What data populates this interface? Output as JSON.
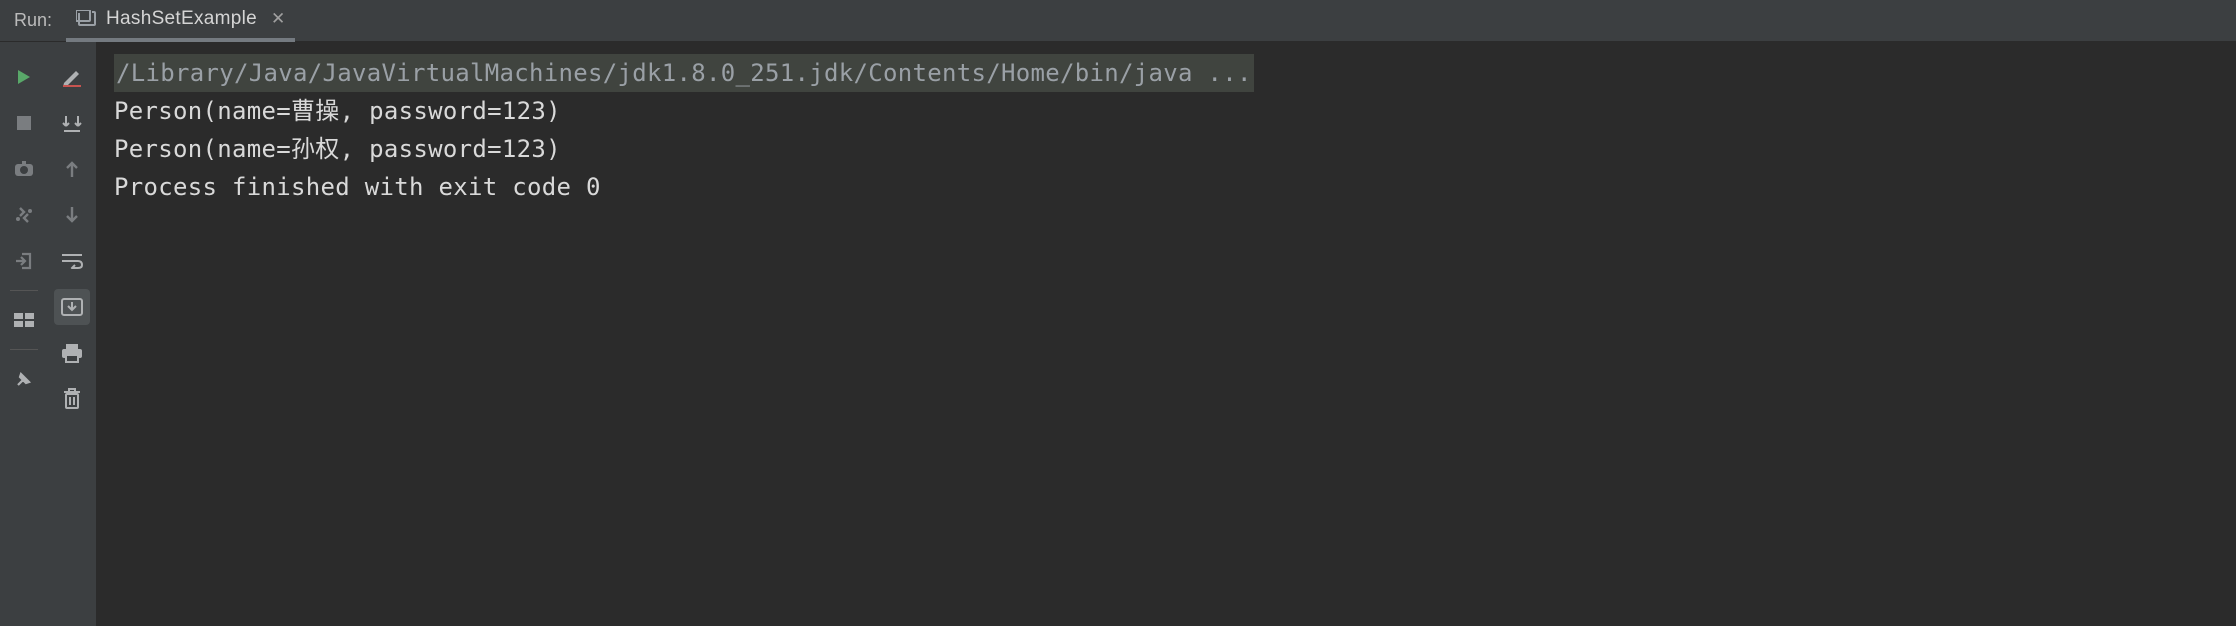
{
  "header": {
    "run_label": "Run:",
    "tab": {
      "label": "HashSetExample"
    }
  },
  "console": {
    "command": "/Library/Java/JavaVirtualMachines/jdk1.8.0_251.jdk/Contents/Home/bin/java ...",
    "lines": [
      "Person(name=曹操, password=123)",
      "Person(name=孙权, password=123)",
      "",
      "Process finished with exit code 0"
    ]
  }
}
